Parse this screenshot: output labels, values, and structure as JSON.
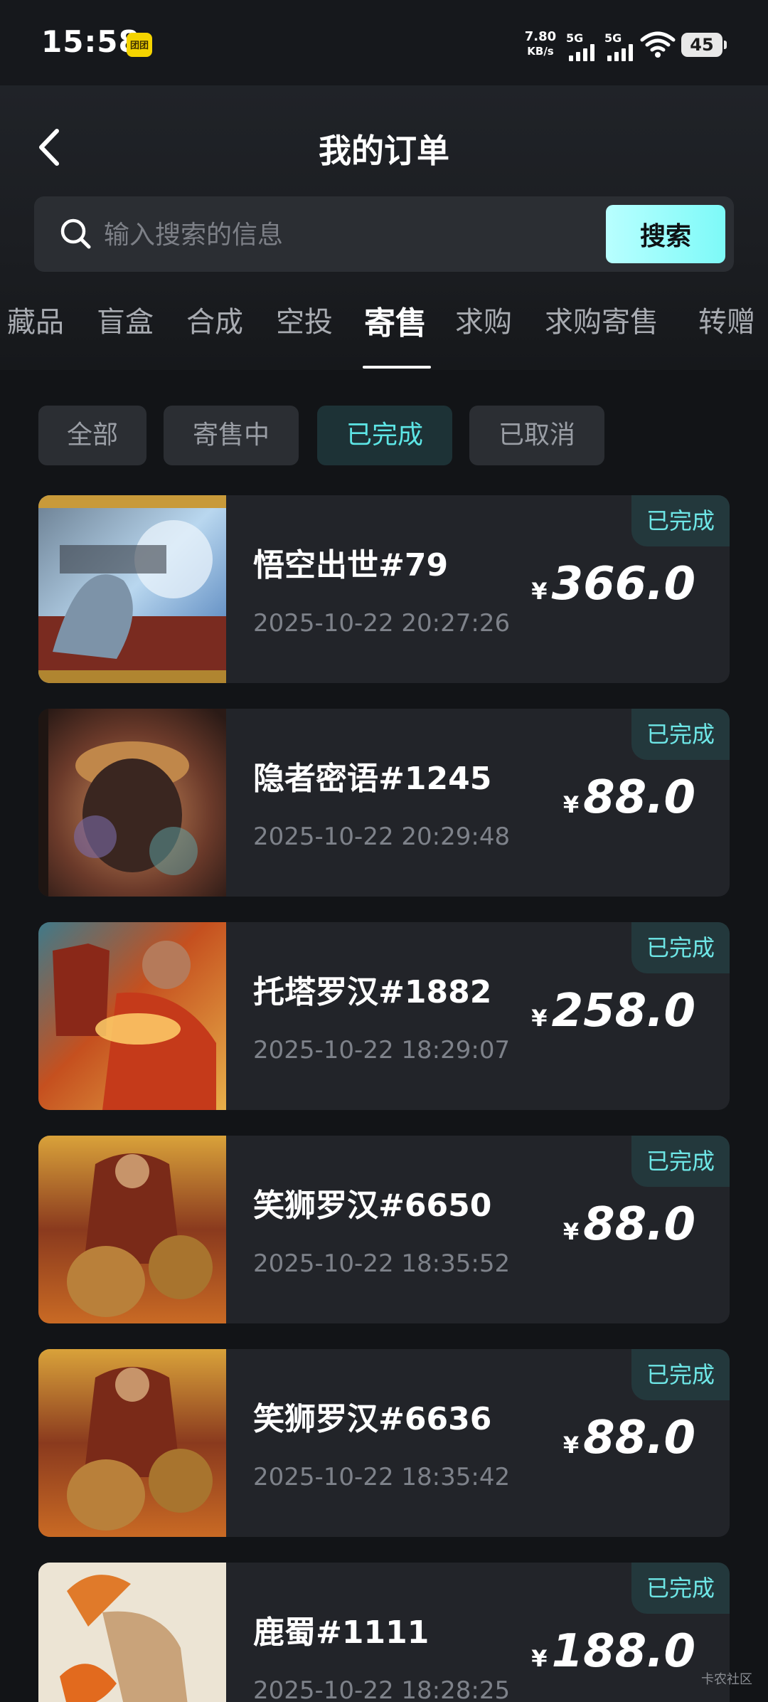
{
  "status_bar": {
    "time": "15:58",
    "notification_badge": "团团",
    "net_speed_value": "7.80",
    "net_speed_unit": "KB/s",
    "signal1_label": "5G",
    "signal2_label": "5G",
    "battery": "45"
  },
  "header": {
    "title": "我的订单"
  },
  "search": {
    "placeholder": "输入搜索的信息",
    "button_label": "搜索"
  },
  "tabs": [
    {
      "label": "藏品"
    },
    {
      "label": "盲盒"
    },
    {
      "label": "合成"
    },
    {
      "label": "空投"
    },
    {
      "label": "寄售",
      "active": true
    },
    {
      "label": "求购"
    },
    {
      "label": "求购寄售"
    },
    {
      "label": "转赠"
    }
  ],
  "filters": [
    {
      "label": "全部"
    },
    {
      "label": "寄售中"
    },
    {
      "label": "已完成",
      "active": true
    },
    {
      "label": "已取消"
    }
  ],
  "orders": [
    {
      "name": "悟空出世#79",
      "time": "2025-10-22 20:27:26",
      "currency": "¥",
      "price": "366.0",
      "status": "已完成"
    },
    {
      "name": "隐者密语#1245",
      "time": "2025-10-22 20:29:48",
      "currency": "¥",
      "price": "88.0",
      "status": "已完成"
    },
    {
      "name": "托塔罗汉#1882",
      "time": "2025-10-22 18:29:07",
      "currency": "¥",
      "price": "258.0",
      "status": "已完成"
    },
    {
      "name": "笑狮罗汉#6650",
      "time": "2025-10-22 18:35:52",
      "currency": "¥",
      "price": "88.0",
      "status": "已完成"
    },
    {
      "name": "笑狮罗汉#6636",
      "time": "2025-10-22 18:35:42",
      "currency": "¥",
      "price": "88.0",
      "status": "已完成"
    },
    {
      "name": "鹿蜀#1111",
      "time": "2025-10-22 18:28:25",
      "currency": "¥",
      "price": "188.0",
      "status": "已完成"
    }
  ],
  "watermark": "卡农社区",
  "colors": {
    "background": "#121417",
    "card": "#222429",
    "accent": "#6ee6e6",
    "search_button": "#8ffcfa"
  }
}
